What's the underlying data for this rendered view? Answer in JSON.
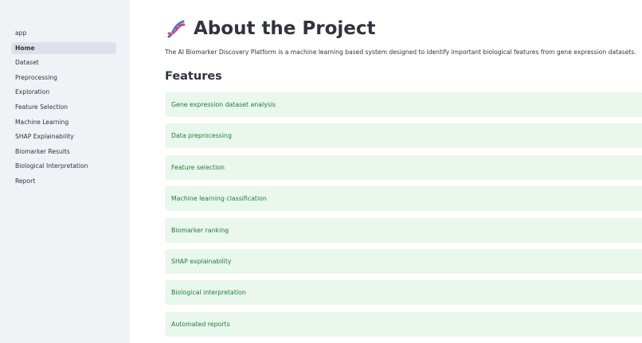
{
  "sidebar": {
    "items": [
      {
        "label": "app"
      },
      {
        "label": "Home",
        "active": true
      },
      {
        "label": "Dataset"
      },
      {
        "label": "Preprocessing"
      },
      {
        "label": "Exploration"
      },
      {
        "label": "Feature Selection"
      },
      {
        "label": "Machine Learning"
      },
      {
        "label": "SHAP Explainability"
      },
      {
        "label": "Biomarker Results"
      },
      {
        "label": "Biological Interpretation"
      },
      {
        "label": "Report"
      }
    ]
  },
  "page": {
    "icon": "dna-icon",
    "title": "About the Project",
    "description": "The AI Biomarker Discovery Platform is a machine learning based system designed to identify important biological features from gene expression datasets.",
    "features_heading": "Features",
    "features": [
      "Gene expression dataset analysis",
      "Data preprocessing",
      "Feature selection",
      "Machine learning classification",
      "Biomarker ranking",
      "SHAP explainability",
      "Biological interpretation",
      "Automated reports"
    ]
  },
  "colors": {
    "sidebar_bg": "#f0f2f6",
    "active_item_bg": "#dde1ea",
    "feature_bg": "#e9f7ec",
    "feature_text": "#1e7c3a",
    "text": "#31333f"
  }
}
